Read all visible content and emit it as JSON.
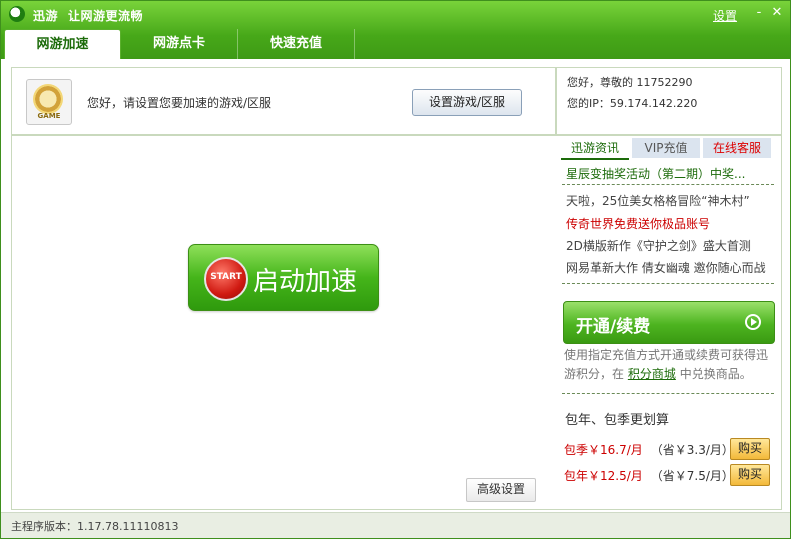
{
  "window": {
    "title_app": "迅游",
    "title_slogan": "让网游更流畅",
    "settings_link": "设置",
    "minimize": "-",
    "close": "✕"
  },
  "tabs": [
    {
      "label": "网游加速",
      "active": true
    },
    {
      "label": "网游点卡",
      "active": false
    },
    {
      "label": "快速充值",
      "active": false
    }
  ],
  "game_panel": {
    "logo_text": "GAME",
    "prompt": "您好，请设置您要加速的游戏/区服",
    "set_button": "设置游戏/区服"
  },
  "user": {
    "greeting": "您好，尊敬的 11752290",
    "ip": "您的IP：59.174.142.220"
  },
  "start": {
    "badge": "START",
    "label": "启动加速"
  },
  "advanced_button": "高级设置",
  "side_tabs": [
    {
      "label": "迅游资讯"
    },
    {
      "label": "VIP充值"
    },
    {
      "label": "在线客服"
    }
  ],
  "news": {
    "headline": "星辰变抽奖活动（第二期）中奖...",
    "items": [
      "天啦，25位美女格格冒险“神木村”",
      "传奇世界免费送你极品账号",
      "2D横版新作《守护之剑》盛大首测",
      "网易革新大作 倩女幽魂 邀你随心而战"
    ]
  },
  "renew": {
    "label": "开通/续费",
    "desc_prefix": "使用指定充值方式开通或续费可获得迅游积分，在",
    "desc_link": "积分商城",
    "desc_suffix": "中兑换商品。"
  },
  "packages": {
    "title": "包年、包季更划算",
    "items": [
      {
        "price": "包季￥16.7/月",
        "save": "（省￥3.3/月）",
        "buy": "购买"
      },
      {
        "price": "包年￥12.5/月",
        "save": "（省￥7.5/月）",
        "buy": "购买"
      }
    ]
  },
  "status": {
    "version": "主程序版本：1.17.78.11110813"
  },
  "colors": {
    "brand_green": "#47a819",
    "accent_red": "#cc0000"
  }
}
